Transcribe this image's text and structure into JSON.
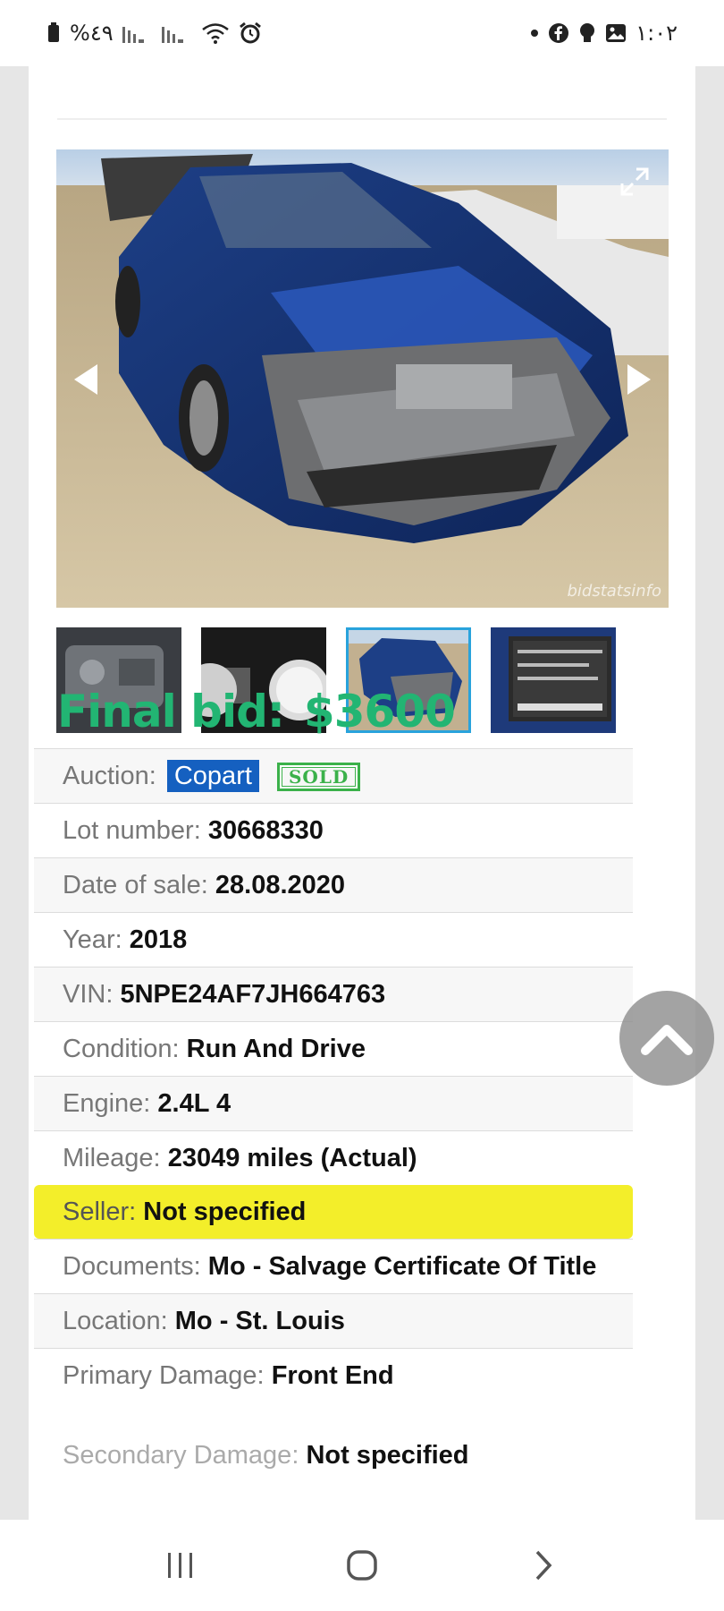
{
  "status_bar": {
    "battery_text": "%٤٩",
    "time": "١:٠٢"
  },
  "listing": {
    "final_bid_label": "Final bid:",
    "final_bid_amount": "$3600",
    "watermark": "bidstatsinfo",
    "rows": [
      {
        "label": "Auction:",
        "value": "Copart",
        "stamp": "SOLD"
      },
      {
        "label": "Lot number:",
        "value": "30668330"
      },
      {
        "label": "Date of sale:",
        "value": "28.08.2020"
      },
      {
        "label": "Year:",
        "value": "2018"
      },
      {
        "label": "VIN:",
        "value": "5NPE24AF7JH664763"
      },
      {
        "label": "Condition:",
        "value": "Run And Drive"
      },
      {
        "label": "Engine:",
        "value": "2.4L 4"
      },
      {
        "label": "Mileage:",
        "value": "23049 miles (Actual)"
      },
      {
        "label": "Seller:",
        "value": "Not specified"
      },
      {
        "label": "Documents:",
        "value": "Mo - Salvage Certificate Of Title"
      },
      {
        "label": "Location:",
        "value": "Mo - St. Louis"
      },
      {
        "label": "Primary Damage:",
        "value": "Front End"
      }
    ],
    "cut_row_label": "Secondary Damage:",
    "cut_row_value": "Not specified"
  },
  "colors": {
    "final_bid": "#22b573",
    "auction_badge": "#1560c0",
    "seller_highlight": "#f3ee2a",
    "active_thumb": "#29a3dc"
  }
}
